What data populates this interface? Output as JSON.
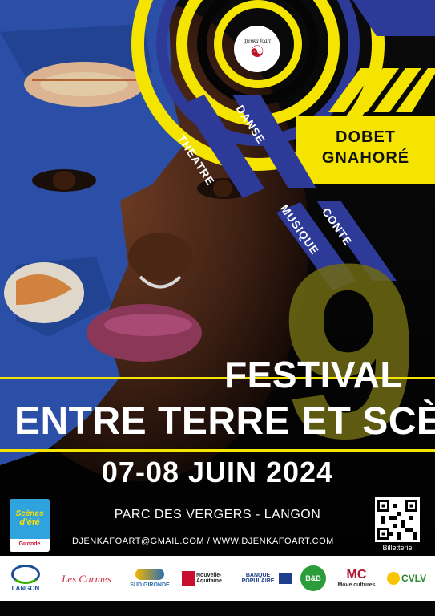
{
  "categories": {
    "theatre": "THEATRE",
    "danse": "DANSE",
    "conte": "CONTE",
    "musique": "MUSIQUE"
  },
  "artist": {
    "line1": "DOBET",
    "line2": "GNAHORÉ"
  },
  "edition_number": "9",
  "logo_text": "djenka foart",
  "festival": {
    "line1": "FESTIVAL",
    "line2": "ENTRE TERRE ET SCÈNE",
    "dates": "07-08 JUIN 2024"
  },
  "venue": "PARC DES VERGERS - LANGON",
  "contact": "DJENKAFOART@GMAIL.COM / WWW.DJENKAFOART.COM",
  "ticketing_label": "Billetterie",
  "left_badge": {
    "line1": "Scènes",
    "line2": "d'été",
    "line3": "Gironde"
  },
  "sponsors": [
    {
      "name": "LANGON",
      "color": "#1b4e9a"
    },
    {
      "name": "Les Carmes",
      "color": "#d0263f"
    },
    {
      "name": "SUD GIRONDE",
      "color": "#2a6fb3"
    },
    {
      "name": "Nouvelle-Aquitaine",
      "color": "#c8102e"
    },
    {
      "name": "BANQUE POPULAIRE",
      "color": "#1d3f8c"
    },
    {
      "name": "B&B",
      "color": "#1f1f1f"
    },
    {
      "name": "Move cultures",
      "color": "#b0122b"
    },
    {
      "name": "CVLV",
      "color": "#e2b400"
    }
  ],
  "colors": {
    "yellow": "#f4e400",
    "blue": "#2e3a97",
    "black": "#050505",
    "white": "#ffffff"
  }
}
